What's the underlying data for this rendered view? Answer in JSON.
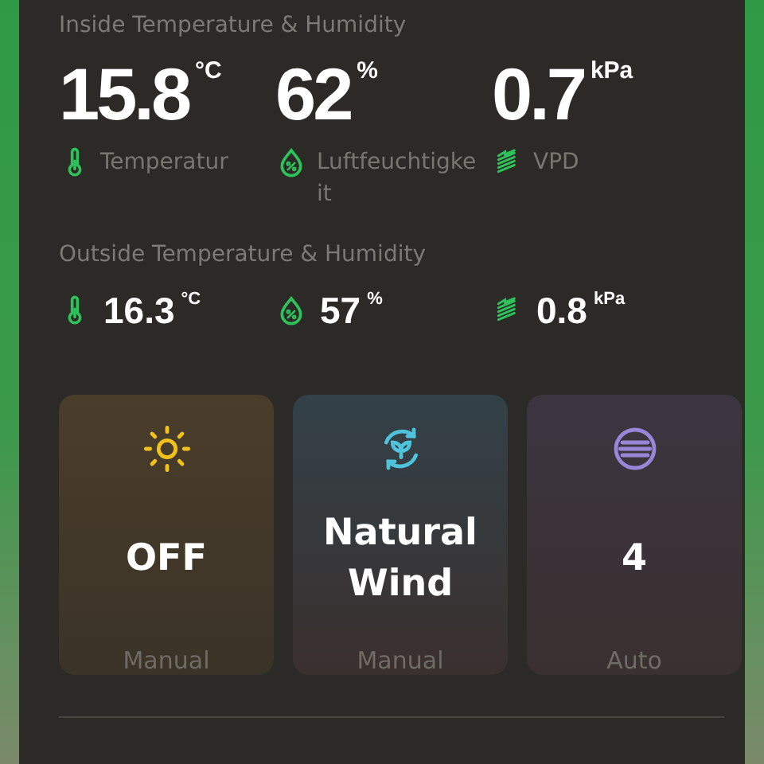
{
  "inside": {
    "title": "Inside Temperature & Humidity",
    "readings": [
      {
        "kind": "temperature",
        "value": "15.8",
        "unit": "°C",
        "label": "Temperatur"
      },
      {
        "kind": "humidity",
        "value": "62",
        "unit": "%",
        "label": "Luftfeuchtigke it"
      },
      {
        "kind": "vpd",
        "value": "0.7",
        "unit": "kPa",
        "label": "VPD"
      }
    ]
  },
  "outside": {
    "title": "Outside Temperature & Humidity",
    "readings": [
      {
        "kind": "temperature",
        "value": "16.3",
        "unit": "°C"
      },
      {
        "kind": "humidity",
        "value": "57",
        "unit": "%"
      },
      {
        "kind": "vpd",
        "value": "0.8",
        "unit": "kPa"
      }
    ]
  },
  "cards": [
    {
      "kind": "light",
      "color": "#f2c21b",
      "value": "OFF",
      "mode": "Manual"
    },
    {
      "kind": "wind",
      "color": "#4fc3dc",
      "value": "Natural Wind",
      "mode": "Manual"
    },
    {
      "kind": "fan",
      "color": "#9a86d8",
      "value": "4",
      "mode": "Auto"
    }
  ]
}
